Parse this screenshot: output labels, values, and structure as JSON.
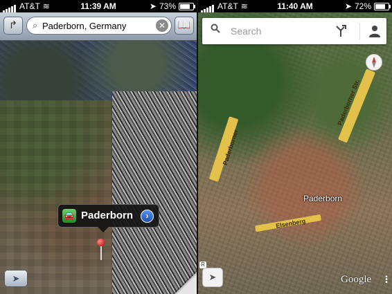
{
  "left_phone": {
    "status": {
      "carrier": "AT&T",
      "time": "11:39 AM",
      "battery": "73%"
    },
    "search_value": "Paderborn, Germany",
    "callout_title": "Paderborn"
  },
  "right_phone": {
    "status": {
      "carrier": "AT&T",
      "time": "11:40 AM",
      "battery": "72%"
    },
    "search_placeholder": "Search",
    "map_labels": {
      "city": "Paderborn",
      "road_left": "Paderborner",
      "road_right": "Paderborner Str.",
      "road_bottom": "Elsenberg"
    },
    "google_logo": "Google"
  },
  "icons": {
    "directions": "directions-arrow-icon",
    "bookmarks": "bookmarks-icon",
    "search": "search-icon",
    "clear": "clear-icon",
    "location": "location-arrow-icon",
    "profile": "profile-icon",
    "compass": "compass-icon"
  },
  "colors": {
    "ios_bar_top": "#c7cfd9",
    "ios_bar_bottom": "#8f9cac",
    "road_yellow": "#e3c14a",
    "pin_red": "#c00000",
    "disclosure_blue": "#1d4fb5"
  }
}
